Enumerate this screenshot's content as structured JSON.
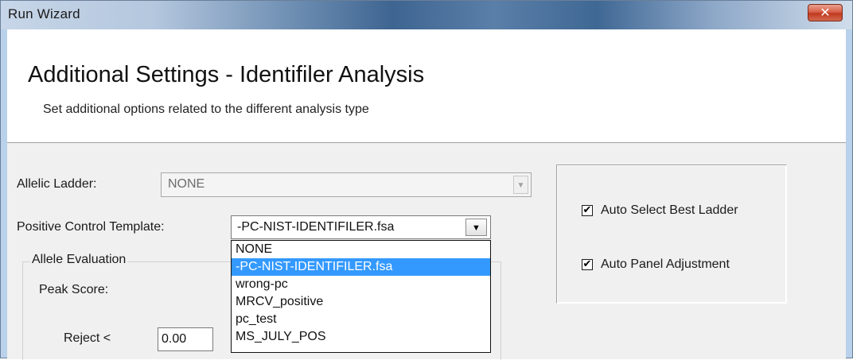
{
  "window": {
    "title": "Run Wizard",
    "close_glyph": "✕"
  },
  "header": {
    "title": "Additional Settings - Identifiler Analysis",
    "subtitle": "Set additional options related to the different analysis type"
  },
  "allelic_ladder": {
    "label": "Allelic Ladder:",
    "value": "NONE"
  },
  "positive_control": {
    "label": "Positive Control Template:",
    "value": "-PC-NIST-IDENTIFILER.fsa",
    "options": [
      "NONE",
      "-PC-NIST-IDENTIFILER.fsa",
      "wrong-pc",
      "MRCV_positive",
      "pc_test",
      "MS_JULY_POS"
    ],
    "selected_index": 1
  },
  "allele_evaluation": {
    "title": "Allele Evaluation",
    "peak_score_label": "Peak Score:",
    "reject_label": "Reject <",
    "reject_value": "0.00"
  },
  "options": {
    "auto_select_best_ladder": {
      "label": "Auto Select Best Ladder",
      "checked": true
    },
    "auto_panel_adjustment": {
      "label": "Auto Panel Adjustment",
      "checked": true
    }
  },
  "icons": {
    "dropdown_arrow": "▼",
    "check": "✔"
  },
  "colors": {
    "selection": "#3399ff",
    "close_button": "#c8412a"
  }
}
